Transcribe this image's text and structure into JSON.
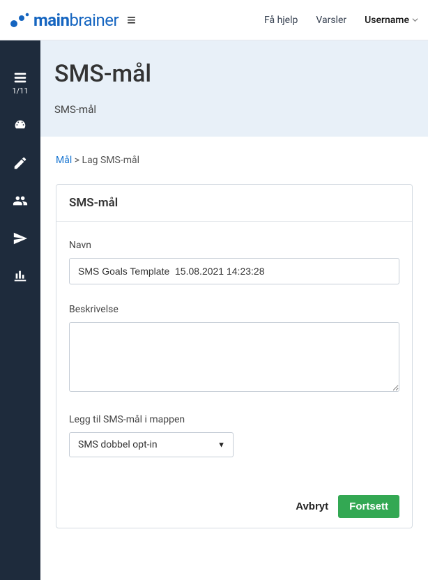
{
  "topbar": {
    "logo_main": "main",
    "logo_sub": "brainer",
    "help_label": "Få hjelp",
    "alerts_label": "Varsler",
    "username_label": "Username"
  },
  "sidebar": {
    "step_label": "1/11"
  },
  "page": {
    "title": "SMS-mål",
    "subtitle": "SMS-mål"
  },
  "breadcrumb": {
    "link_label": "Mål",
    "current": "Lag SMS-mål"
  },
  "card": {
    "header": "SMS-mål",
    "name_label": "Navn",
    "name_value": "SMS Goals Template  15.08.2021 14:23:28",
    "desc_label": "Beskrivelse",
    "desc_value": "",
    "folder_label": "Legg til SMS-mål i mappen",
    "folder_value": "SMS dobbel opt-in",
    "cancel_label": "Avbryt",
    "continue_label": "Fortsett"
  }
}
